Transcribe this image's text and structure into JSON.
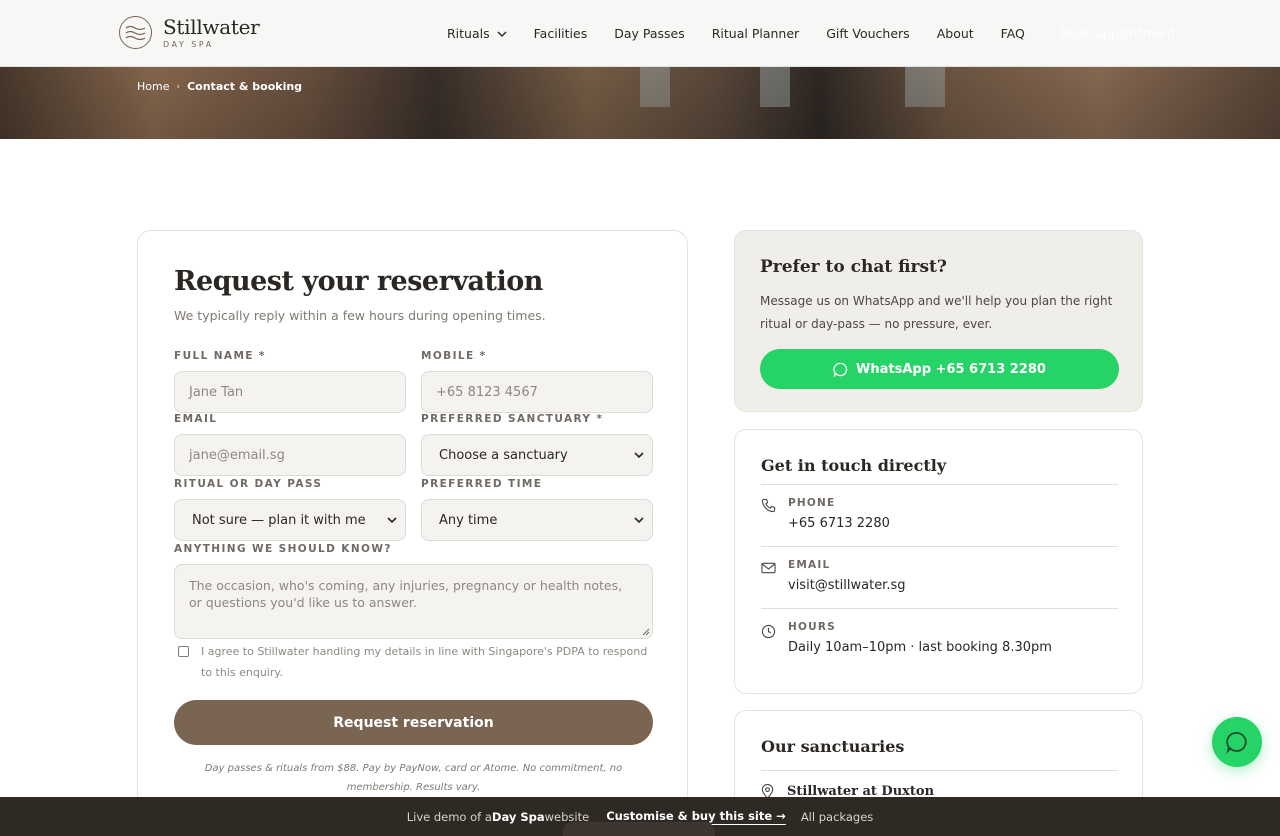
{
  "header": {
    "logo_name": "Stillwater",
    "logo_sub": "DAY SPA",
    "nav": [
      "Rituals",
      "Facilities",
      "Day Passes",
      "Ritual Planner",
      "Gift Vouchers",
      "About",
      "FAQ"
    ],
    "book_label": "Book appointment"
  },
  "breadcrumb": {
    "home": "Home",
    "current": "Contact & booking"
  },
  "form": {
    "title": "Request your reservation",
    "subtitle": "We typically reply within a few hours during opening times.",
    "full_name_label": "FULL NAME *",
    "full_name_placeholder": "Jane Tan",
    "mobile_label": "MOBILE *",
    "mobile_placeholder": "+65 8123 4567",
    "email_label": "EMAIL",
    "email_placeholder": "jane@email.sg",
    "sanctuary_label": "PREFERRED SANCTUARY *",
    "sanctuary_value": "Choose a sanctuary",
    "ritual_label": "RITUAL OR DAY PASS",
    "ritual_value": "Not sure — plan it with me",
    "time_label": "PREFERRED TIME",
    "time_value": "Any time",
    "notes_label": "ANYTHING WE SHOULD KNOW?",
    "notes_placeholder": "The occasion, who's coming, any injuries, pregnancy or health notes, or questions you'd like us to answer.",
    "consent": "I agree to Stillwater handling my details in line with Singapore's PDPA to respond to this enquiry.",
    "submit": "Request reservation",
    "fineprint": "Day passes & rituals from $88. Pay by PayNow, card or Atome. No commitment, no membership. Results vary."
  },
  "chat": {
    "title": "Prefer to chat first?",
    "text": "Message us on WhatsApp and we'll help you plan the right ritual or day-pass — no pressure, ever.",
    "button": "WhatsApp +65 6713 2280"
  },
  "contact": {
    "title": "Get in touch directly",
    "phone_label": "PHONE",
    "phone": "+65 6713 2280",
    "email_label": "EMAIL",
    "email": "visit@stillwater.sg",
    "hours_label": "HOURS",
    "hours": "Daily 10am–10pm · last booking 8.30pm"
  },
  "sanctuaries": {
    "title": "Our sanctuaries",
    "first": "Stillwater at Duxton"
  },
  "demobar": {
    "prefix": "Live demo of a ",
    "type": "Day Spa",
    "suffix": " website",
    "cta": "Customise & buy this site →",
    "packages": "All packages"
  },
  "colors": {
    "brand": "#7a6452",
    "whatsapp": "#25d366",
    "dark": "#2f2924"
  }
}
